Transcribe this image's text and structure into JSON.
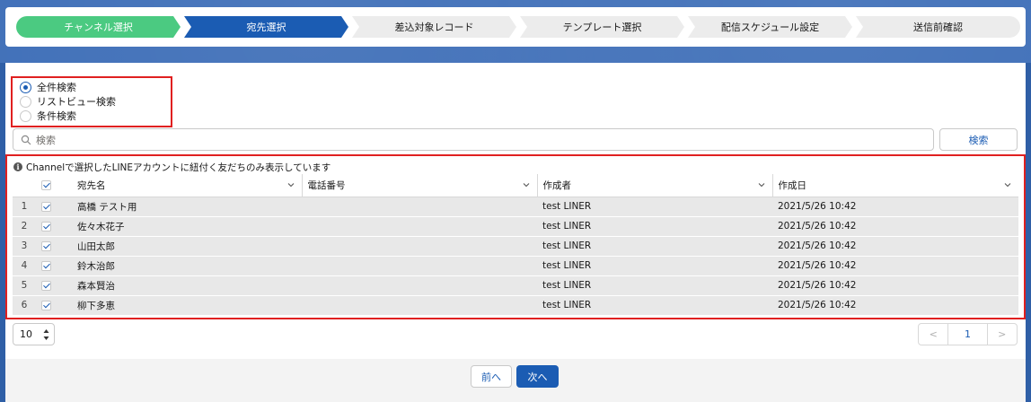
{
  "progress": {
    "steps": [
      "チャンネル選択",
      "宛先選択",
      "差込対象レコード",
      "テンプレート選択",
      "配信スケジュール設定",
      "送信前確認"
    ]
  },
  "scope": {
    "options": [
      "全件検索",
      "リストビュー検索",
      "条件検索"
    ],
    "selected": "全件検索"
  },
  "search": {
    "placeholder": "検索",
    "button_label": "検索"
  },
  "notice": "Channelで選択したLINEアカウントに紐付く友だちのみ表示しています",
  "table": {
    "columns": [
      "宛先名",
      "電話番号",
      "作成者",
      "作成日"
    ],
    "rows": [
      {
        "num": "1",
        "name": "高橋 テスト用",
        "phone": "",
        "owner": "test LINER",
        "created": "2021/5/26 10:42"
      },
      {
        "num": "2",
        "name": "佐々木花子",
        "phone": "",
        "owner": "test LINER",
        "created": "2021/5/26 10:42"
      },
      {
        "num": "3",
        "name": "山田太郎",
        "phone": "",
        "owner": "test LINER",
        "created": "2021/5/26 10:42"
      },
      {
        "num": "4",
        "name": "鈴木治郎",
        "phone": "",
        "owner": "test LINER",
        "created": "2021/5/26 10:42"
      },
      {
        "num": "5",
        "name": "森本賢治",
        "phone": "",
        "owner": "test LINER",
        "created": "2021/5/26 10:42"
      },
      {
        "num": "6",
        "name": "柳下多恵",
        "phone": "",
        "owner": "test LINER",
        "created": "2021/5/26 10:42"
      }
    ]
  },
  "pagination": {
    "page_size": "10",
    "prev": "<",
    "current": "1",
    "next": ">"
  },
  "footer": {
    "back_label": "前へ",
    "next_label": "次へ"
  },
  "colors": {
    "accent": "#1b5cb3",
    "done": "#4bca81",
    "highlight": "#e02020"
  }
}
